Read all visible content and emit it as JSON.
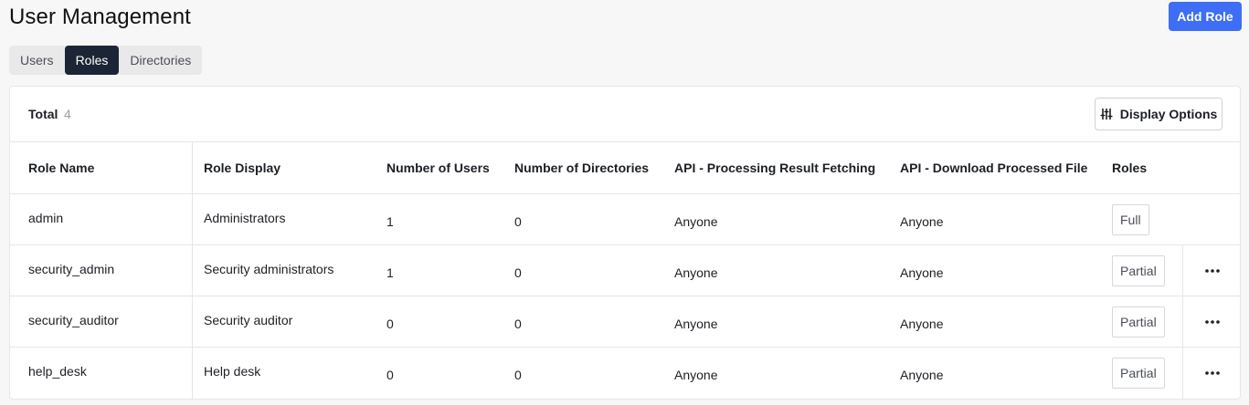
{
  "page": {
    "title": "User Management"
  },
  "header": {
    "add_role_label": "Add Role"
  },
  "tabs": [
    {
      "label": "Users",
      "active": false
    },
    {
      "label": "Roles",
      "active": true
    },
    {
      "label": "Directories",
      "active": false
    }
  ],
  "summary": {
    "total_label": "Total",
    "total_count": "4",
    "display_options_label": "Display Options"
  },
  "table": {
    "columns": [
      "Role Name",
      "Role Display",
      "Number of Users",
      "Number of Directories",
      "API - Processing Result Fetching",
      "API - Download Processed File",
      "Roles"
    ],
    "rows": [
      {
        "role_name": "admin",
        "role_display": "Administrators",
        "users": "1",
        "directories": "0",
        "api_fetching": "Anyone",
        "api_download": "Anyone",
        "roles": "Full",
        "has_menu": false
      },
      {
        "role_name": "security_admin",
        "role_display": "Security administrators",
        "users": "1",
        "directories": "0",
        "api_fetching": "Anyone",
        "api_download": "Anyone",
        "roles": "Partial",
        "has_menu": true
      },
      {
        "role_name": "security_auditor",
        "role_display": "Security auditor",
        "users": "0",
        "directories": "0",
        "api_fetching": "Anyone",
        "api_download": "Anyone",
        "roles": "Partial",
        "has_menu": true
      },
      {
        "role_name": "help_desk",
        "role_display": "Help desk",
        "users": "0",
        "directories": "0",
        "api_fetching": "Anyone",
        "api_download": "Anyone",
        "roles": "Partial",
        "has_menu": true
      }
    ]
  },
  "icons": {
    "display_options": "sliders-icon",
    "row_menu": "more-horizontal-icon"
  },
  "colors": {
    "primary": "#3d6ef5",
    "active_tab": "#1c2535"
  }
}
